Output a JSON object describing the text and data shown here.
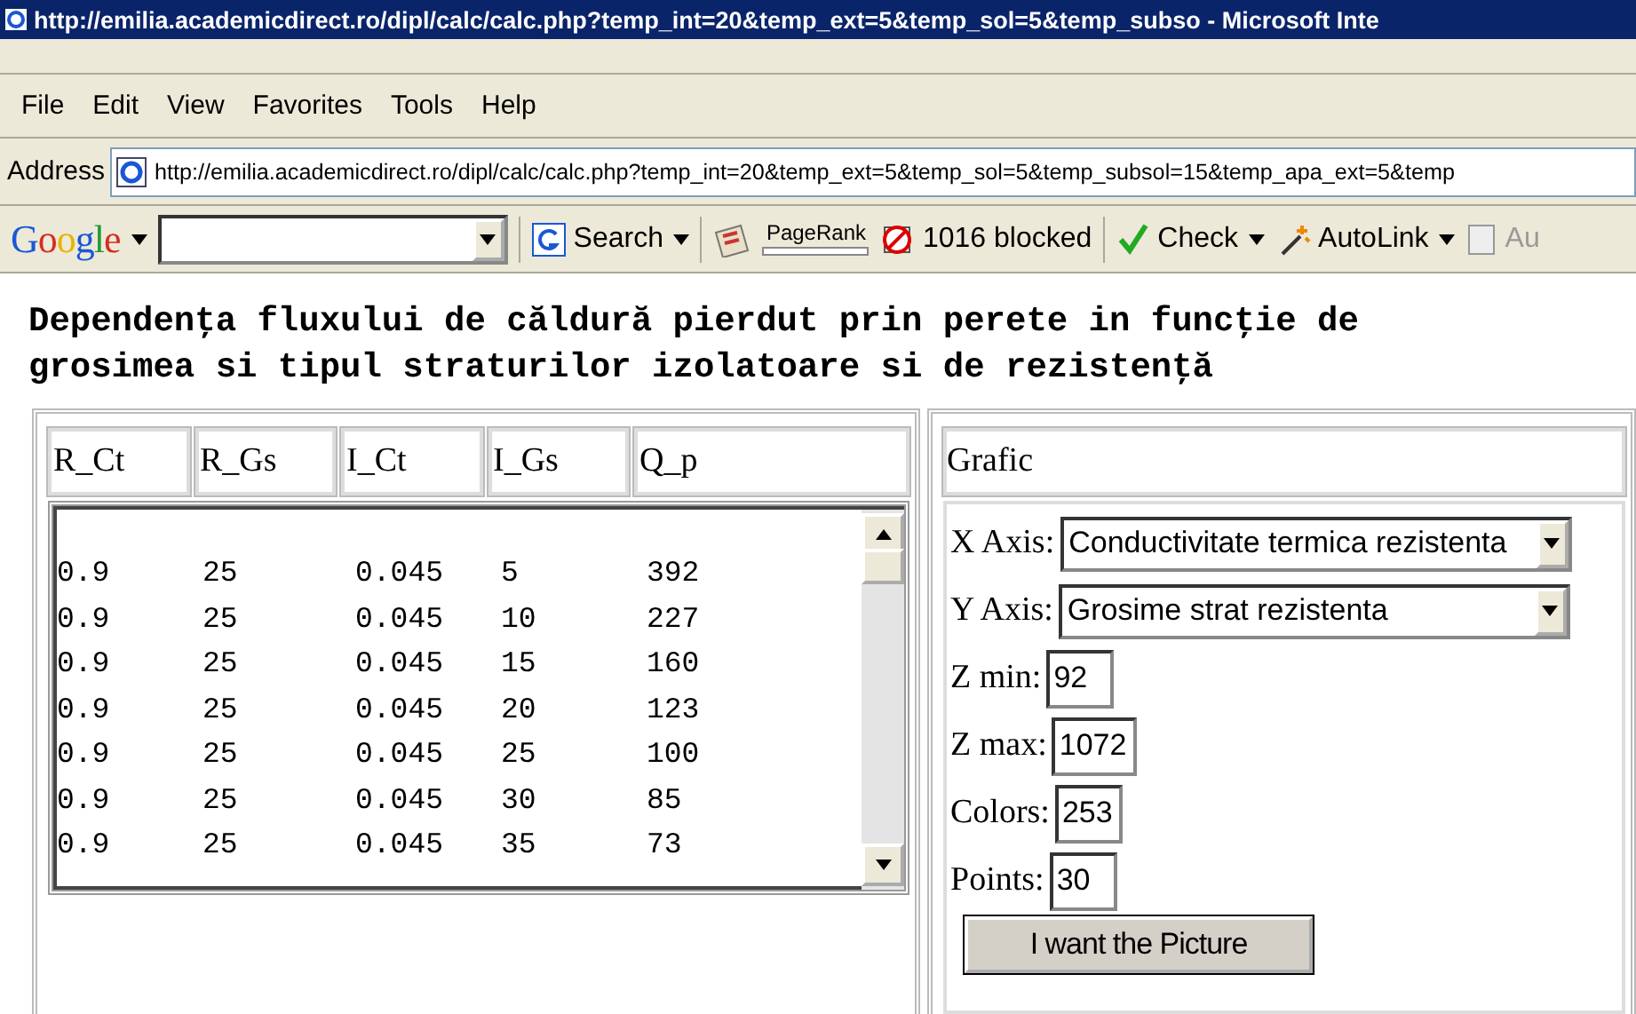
{
  "window": {
    "title": "http://emilia.academicdirect.ro/dipl/calc/calc.php?temp_int=20&temp_ext=5&temp_sol=5&temp_subso - Microsoft Inte"
  },
  "menu": [
    "File",
    "Edit",
    "View",
    "Favorites",
    "Tools",
    "Help"
  ],
  "address_bar": {
    "label": "Address",
    "url": "http://emilia.academicdirect.ro/dipl/calc/calc.php?temp_int=20&temp_ext=5&temp_sol=5&temp_subsol=15&temp_apa_ext=5&temp"
  },
  "google_toolbar": {
    "logo": "Google",
    "search_button": "Search",
    "pagerank": "PageRank",
    "blocked": "1016 blocked",
    "check": "Check",
    "autolink": "AutoLink",
    "cut_item": "Au"
  },
  "heading": [
    "Dependenţa fluxului de căldură pierdut prin perete in funcţie de",
    "grosimea si tipul straturilor izolatoare si de rezistenţă"
  ],
  "table": {
    "columns": [
      "R_Ct",
      "R_Gs",
      "I_Ct",
      "I_Gs",
      "Q_p"
    ],
    "rows": [
      [
        "0.9",
        "25",
        "0.045",
        "5",
        "392"
      ],
      [
        "0.9",
        "25",
        "0.045",
        "10",
        "227"
      ],
      [
        "0.9",
        "25",
        "0.045",
        "15",
        "160"
      ],
      [
        "0.9",
        "25",
        "0.045",
        "20",
        "123"
      ],
      [
        "0.9",
        "25",
        "0.045",
        "25",
        "100"
      ],
      [
        "0.9",
        "25",
        "0.045",
        "30",
        "85"
      ],
      [
        "0.9",
        "25",
        "0.045",
        "35",
        "73"
      ]
    ]
  },
  "graph_panel": {
    "title": "Grafic",
    "selects": [
      {
        "label": "X Axis:",
        "value": "Conductivitate termica rezistenta"
      },
      {
        "label": "Y Axis:",
        "value": "Grosime strat rezistenta"
      }
    ],
    "fields": [
      {
        "label": "Z min:",
        "value": "92"
      },
      {
        "label": "Z max:",
        "value": "1072"
      },
      {
        "label": "Colors:",
        "value": "253"
      },
      {
        "label": "Points:",
        "value": "30"
      }
    ],
    "button": "I want the Picture"
  }
}
